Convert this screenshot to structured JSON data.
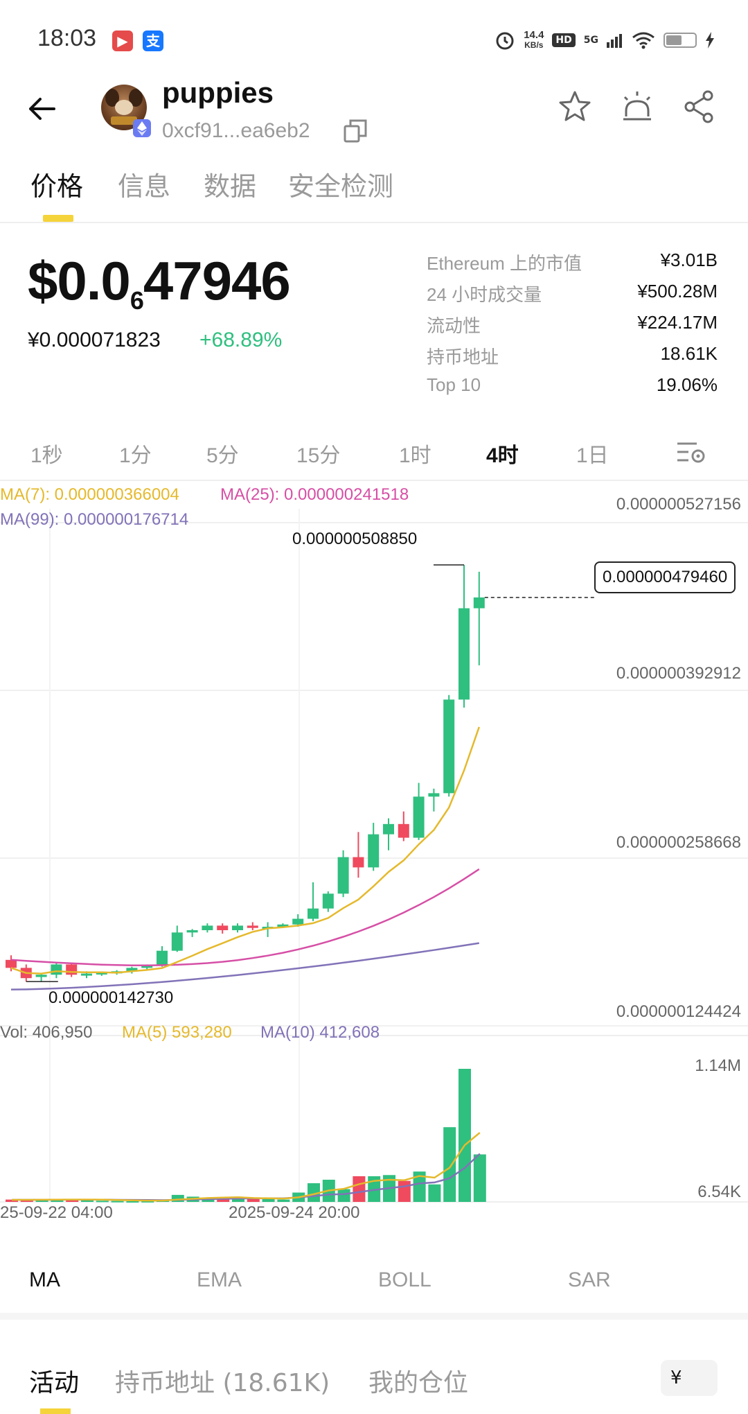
{
  "status_bar": {
    "time": "18:03",
    "net_speed_value": "14.4",
    "net_speed_unit": "KB/s",
    "hd": "HD",
    "network": "5G",
    "battery_level": 0.55
  },
  "header": {
    "token_name": "puppies",
    "token_address": "0xcf91...ea6eb2"
  },
  "tabs": [
    "价格",
    "信息",
    "数据",
    "安全检测"
  ],
  "price": {
    "main_prefix": "$0.0",
    "main_zero_count": "6",
    "main_digits": "47946",
    "cny": "¥0.000071823",
    "change": "+68.89%"
  },
  "stats": [
    {
      "label": "Ethereum 上的市值",
      "value": "¥3.01B"
    },
    {
      "label": "24 小时成交量",
      "value": "¥500.28M"
    },
    {
      "label": "流动性",
      "value": "¥224.17M"
    },
    {
      "label": "持币地址",
      "value": "18.61K"
    },
    {
      "label": "Top 10",
      "value": "19.06%"
    }
  ],
  "timeframes": [
    "1秒",
    "1分",
    "5分",
    "15分",
    "1时",
    "4时",
    "1日"
  ],
  "active_timeframe": "4时",
  "ma_legend": {
    "ma7": "MA(7): 0.000000366004",
    "ma25": "MA(25): 0.000000241518",
    "ma99": "MA(99): 0.000000176714"
  },
  "price_axis": [
    "0.000000527156",
    "0.000000392912",
    "0.000000258668",
    "0.000000124424"
  ],
  "current_price_tag": "0.000000479460",
  "high_label": "0.000000508850",
  "low_label": "0.000000142730",
  "volume_legend": {
    "vol": "Vol: 406,950",
    "ma5": "MA(5) 593,280",
    "ma10": "MA(10) 412,608"
  },
  "volume_axis": [
    "1.14M",
    "6.54K"
  ],
  "dates": [
    "25-09-22 04:00",
    "2025-09-24 20:00"
  ],
  "indicators": [
    "MA",
    "EMA",
    "BOLL",
    "SAR"
  ],
  "bottom_tabs": [
    "活动",
    "持币地址 (18.61K)",
    "我的仓位"
  ],
  "currency": "¥",
  "colors": {
    "up": "#2fbf7f",
    "down": "#ef4a5e",
    "ma7": "#e5b92c",
    "ma25": "#d64fa6",
    "ma99": "#8272b8",
    "accent": "#f5d33a"
  },
  "chart_data": {
    "type": "candlestick",
    "interval": "4时",
    "candles": [
      {
        "o": 1.62e-07,
        "h": 1.66e-07,
        "l": 1.52e-07,
        "c": 1.55e-07
      },
      {
        "o": 1.55e-07,
        "h": 1.58e-07,
        "l": 1.43e-07,
        "c": 1.46e-07
      },
      {
        "o": 1.47e-07,
        "h": 1.5e-07,
        "l": 1.43e-07,
        "c": 1.49e-07
      },
      {
        "o": 1.49e-07,
        "h": 1.6e-07,
        "l": 1.46e-07,
        "c": 1.58e-07
      },
      {
        "o": 1.58e-07,
        "h": 1.59e-07,
        "l": 1.47e-07,
        "c": 1.49e-07
      },
      {
        "o": 1.49e-07,
        "h": 1.52e-07,
        "l": 1.46e-07,
        "c": 1.5e-07
      },
      {
        "o": 1.5e-07,
        "h": 1.51e-07,
        "l": 1.48e-07,
        "c": 1.51e-07
      },
      {
        "o": 1.51e-07,
        "h": 1.53e-07,
        "l": 1.49e-07,
        "c": 1.52e-07
      },
      {
        "o": 1.52e-07,
        "h": 1.56e-07,
        "l": 1.5e-07,
        "c": 1.55e-07
      },
      {
        "o": 1.55e-07,
        "h": 1.58e-07,
        "l": 1.53e-07,
        "c": 1.57e-07
      },
      {
        "o": 1.57e-07,
        "h": 1.74e-07,
        "l": 1.56e-07,
        "c": 1.7e-07
      },
      {
        "o": 1.7e-07,
        "h": 1.92e-07,
        "l": 1.69e-07,
        "c": 1.86e-07
      },
      {
        "o": 1.86e-07,
        "h": 1.89e-07,
        "l": 1.82e-07,
        "c": 1.88e-07
      },
      {
        "o": 1.88e-07,
        "h": 1.94e-07,
        "l": 1.86e-07,
        "c": 1.92e-07
      },
      {
        "o": 1.92e-07,
        "h": 1.94e-07,
        "l": 1.85e-07,
        "c": 1.88e-07
      },
      {
        "o": 1.88e-07,
        "h": 1.94e-07,
        "l": 1.86e-07,
        "c": 1.92e-07
      },
      {
        "o": 1.92e-07,
        "h": 1.95e-07,
        "l": 1.88e-07,
        "c": 1.9e-07
      },
      {
        "o": 1.9e-07,
        "h": 1.95e-07,
        "l": 1.82e-07,
        "c": 1.91e-07
      },
      {
        "o": 1.91e-07,
        "h": 1.94e-07,
        "l": 1.9e-07,
        "c": 1.93e-07
      },
      {
        "o": 1.93e-07,
        "h": 2.02e-07,
        "l": 1.91e-07,
        "c": 1.98e-07
      },
      {
        "o": 1.98e-07,
        "h": 2.3e-07,
        "l": 1.96e-07,
        "c": 2.07e-07
      },
      {
        "o": 2.07e-07,
        "h": 2.22e-07,
        "l": 2.04e-07,
        "c": 2.2e-07
      },
      {
        "o": 2.2e-07,
        "h": 2.58e-07,
        "l": 2.17e-07,
        "c": 2.52e-07
      },
      {
        "o": 2.52e-07,
        "h": 2.74e-07,
        "l": 2.34e-07,
        "c": 2.43e-07
      },
      {
        "o": 2.43e-07,
        "h": 2.82e-07,
        "l": 2.4e-07,
        "c": 2.72e-07
      },
      {
        "o": 2.72e-07,
        "h": 2.86e-07,
        "l": 2.58e-07,
        "c": 2.81e-07
      },
      {
        "o": 2.81e-07,
        "h": 2.92e-07,
        "l": 2.66e-07,
        "c": 2.69e-07
      },
      {
        "o": 2.69e-07,
        "h": 3.17e-07,
        "l": 2.67e-07,
        "c": 3.05e-07
      },
      {
        "o": 3.05e-07,
        "h": 3.12e-07,
        "l": 2.92e-07,
        "c": 3.08e-07
      },
      {
        "o": 3.08e-07,
        "h": 3.94e-07,
        "l": 3.05e-07,
        "c": 3.9e-07
      },
      {
        "o": 3.9e-07,
        "h": 5.08e-07,
        "l": 3.83e-07,
        "c": 4.7e-07
      },
      {
        "o": 4.7e-07,
        "h": 5.02e-07,
        "l": 4.2e-07,
        "c": 4.7946e-07
      }
    ],
    "ma7_end": 3.66004e-07,
    "ma25_end": 2.41518e-07,
    "ma99_end": 1.76714e-07,
    "volumes": [
      20000,
      16000,
      18000,
      24000,
      21000,
      20000,
      10000,
      8000,
      6000,
      7000,
      20000,
      60000,
      45000,
      30000,
      28000,
      35000,
      26000,
      32000,
      20000,
      80000,
      160000,
      190000,
      110000,
      220000,
      220000,
      230000,
      180000,
      260000,
      150000,
      640000,
      1140000,
      406950
    ],
    "volume_ma5": [
      18000,
      18000,
      18500,
      19000,
      20000,
      20000,
      19000,
      16000,
      13000,
      11000,
      11000,
      20000,
      27000,
      33000,
      37000,
      40000,
      33000,
      31000,
      28000,
      39000,
      66000,
      98000,
      112000,
      152000,
      180000,
      190000,
      186000,
      222000,
      208000,
      293000,
      486000,
      593280
    ],
    "volume_ma10": [
      18000,
      18000,
      18000,
      18500,
      19000,
      19000,
      19000,
      18000,
      17000,
      16000,
      15000,
      18000,
      21000,
      24000,
      26000,
      29000,
      30000,
      30000,
      30000,
      39000,
      50000,
      63000,
      67000,
      84000,
      102000,
      118000,
      133000,
      158000,
      167000,
      203000,
      291000,
      412608
    ],
    "price_ylim": [
      1.2e-07,
      5.45e-07
    ],
    "volume_ylim": [
      0,
      1140000.0
    ],
    "x_labels": [
      "25-09-22 04:00",
      "2025-09-24 20:00"
    ]
  }
}
